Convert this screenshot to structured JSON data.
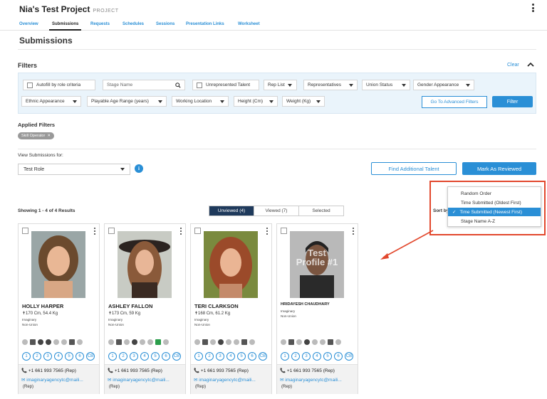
{
  "header": {
    "project": "Nia's Test Project",
    "project_tag": "PROJECT"
  },
  "tabs": [
    "Overview",
    "Submissions",
    "Requests",
    "Schedules",
    "Sessions",
    "Presentation Links",
    "Worksheet"
  ],
  "page_title": "Submissions",
  "filters": {
    "heading": "Filters",
    "clear_label": "Clear",
    "autofill_label": "Autofill by role criteria",
    "stage_name_placeholder": "Stage Name",
    "unrepresented_label": "Unrepresented Talent",
    "dropdowns_row1": [
      "Rep List",
      "Representatives",
      "Union Status",
      "Gender Appearance"
    ],
    "dropdowns_row2": [
      "Ethnic Appearance",
      "Playable Age Range (years)",
      "Working Location",
      "Height (Cm)",
      "Weight (Kg)"
    ],
    "advanced_label": "Go To Advanced Filters",
    "filter_button": "Filter"
  },
  "applied_filters": {
    "heading": "Applied Filters",
    "chips": [
      "Skill Operator"
    ]
  },
  "view_for": {
    "label": "View Submissions for:",
    "selected": "Test Role",
    "info_glyph": "i"
  },
  "actions": {
    "find_talent": "Find Additional Talent",
    "mark_reviewed": "Mark As Reviewed"
  },
  "results": {
    "showing": "Showing 1 - 4 of 4 Results",
    "segments": [
      "Unviewed (4)",
      "Viewed (7)",
      "Selected"
    ],
    "sort_label": "Sort by"
  },
  "sort_menu": {
    "options": [
      "Random Order",
      "Time Submitted (Oldest First)",
      "Time Submitted (Newest First)",
      "Stage Name A-Z"
    ],
    "selected_index": 2,
    "check_glyph": "✓"
  },
  "accent_colors": {
    "primary": "#2a8fd6",
    "dark_segment": "#1f3a5c",
    "highlight": "#e2482d"
  },
  "card_common": {
    "phone": "+1 661 993 7565 (Rep)",
    "email": "imaginaryagencytc@maili...",
    "rep": "(Rep)",
    "role_numbers": [
      "1",
      "2",
      "3",
      "4",
      "5",
      "6",
      "CB"
    ],
    "phone_glyph": "📞",
    "email_glyph": "✉",
    "measure_glyph": "✝"
  },
  "cards": [
    {
      "name": "HOLLY HARPER",
      "measurements": "170 Cm, 54.4 Kg",
      "agency": "Imaginary",
      "union": "Non-Union"
    },
    {
      "name": "ASHLEY FALLON",
      "measurements": "173 Cm, 59 Kg",
      "agency": "Imaginary",
      "union": "Non-Union"
    },
    {
      "name": "TERI CLARKSON",
      "measurements": "168 Cm, 61.2 Kg",
      "agency": "Imaginary",
      "union": "Non-Union"
    },
    {
      "name": "HRIDAYESH CHAUDHARY",
      "measurements": "",
      "agency": "Imaginary",
      "union": "Non-Union",
      "photo_overlay": "Test Profile #1"
    }
  ]
}
